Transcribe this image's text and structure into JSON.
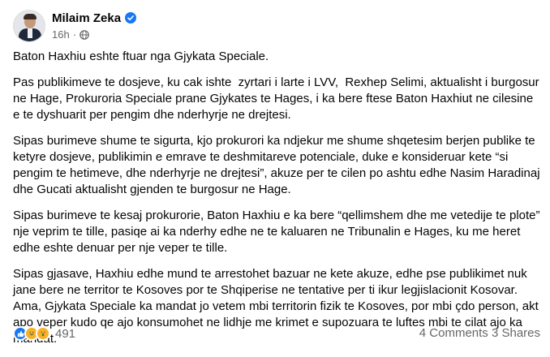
{
  "post": {
    "author": "Milaim Zeka",
    "time": "16h",
    "separator": "·",
    "icons": {
      "verified": "verified-badge-icon",
      "audience": "globe-icon"
    },
    "paragraphs": [
      "Baton Haxhiu eshte ftuar nga Gjykata Speciale.",
      "Pas publikimeve te dosjeve, ku cak ishte  zyrtari i larte i LVV,  Rexhep Selimi, aktualisht i burgosur ne Hage, Prokuroria Speciale prane Gjykates te Hages, i ka bere ftese Baton Haxhiut ne cilesine e te dyshuarit per pengim dhe nderhyrje ne drejtesi.",
      "Sipas burimeve shume te sigurta, kjo prokurori ka ndjekur me shume shqetesim berjen publike te ketyre dosjeve, publikimin e emrave te deshmitareve potenciale, duke e konsideruar kete “si pengim te hetimeve, dhe nderhyrje ne drejtesi”, akuze per te cilen po ashtu edhe Nasim Haradinaj dhe Gucati aktualisht gjenden te burgosur ne Hage.",
      "Sipas burimeve te kesaj prokurorie, Baton Haxhiu e ka bere “qellimshem dhe me vetedije te plote” nje veprim te tille, pasiqe ai ka nderhy edhe ne te kaluaren ne Tribunalin e Hages, ku me heret edhe eshte denuar per nje veper te tille.",
      "Sipas gjasave, Haxhiu edhe mund te arrestohet bazuar ne kete akuze, edhe pse publikimet nuk jane bere ne territor te Kosoves por te Shqiperise ne tentative per ti ikur legjislacionit Kosovar. Ama, Gjykata Speciale ka mandat jo vetem mbi territorin fizik te Kosoves, por mbi çdo person, akt apo veper kudo qe ajo konsumohet ne lidhje me krimet e supozuara te luftes mbi te cilat ajo ka mandat."
    ],
    "footer": {
      "reaction_count": "491",
      "stats": "4 Comments  3 Shares"
    },
    "colors": {
      "accent": "#1877f2",
      "secondary_text": "#65676b",
      "text": "#050505"
    }
  }
}
